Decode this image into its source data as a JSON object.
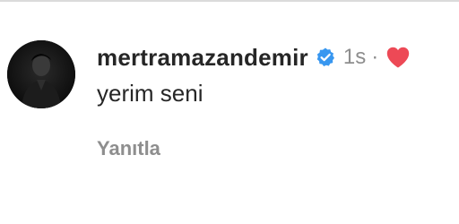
{
  "comment": {
    "username": "mertramazandemir",
    "verified": true,
    "timestamp": "1s",
    "separator": "·",
    "text": "yerim seni",
    "reply_label": "Yanıtla",
    "liked_by_author": true
  },
  "colors": {
    "username": "#262626",
    "text": "#262626",
    "muted": "#8e8e8e",
    "verified_badge": "#3897f0",
    "heart": "#ed4956"
  },
  "icons": {
    "verified": "verified-badge-icon",
    "heart": "heart-icon",
    "avatar": "profile-photo"
  }
}
